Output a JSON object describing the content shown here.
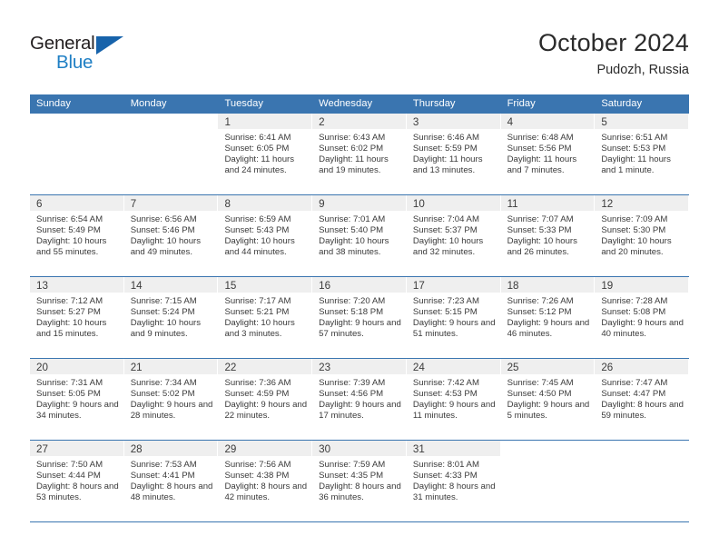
{
  "brand": {
    "name_top": "General",
    "name_bottom": "Blue",
    "accent_color": "#1763ab",
    "text_color": "#231f20"
  },
  "header": {
    "title": "October 2024",
    "subtitle": "Pudozh, Russia"
  },
  "theme": {
    "header_blue": "#3a75b0",
    "daynum_band": "#efefef",
    "cell_bg": "#ffffff",
    "text": "#3a3a3a"
  },
  "calendar": {
    "weekdays": [
      "Sunday",
      "Monday",
      "Tuesday",
      "Wednesday",
      "Thursday",
      "Friday",
      "Saturday"
    ],
    "labels": {
      "sunrise": "Sunrise:",
      "sunset": "Sunset:",
      "daylight": "Daylight:"
    },
    "weeks": [
      [
        {
          "day": "",
          "sunrise": "",
          "sunset": "",
          "daylight": ""
        },
        {
          "day": "",
          "sunrise": "",
          "sunset": "",
          "daylight": ""
        },
        {
          "day": "1",
          "sunrise": "Sunrise: 6:41 AM",
          "sunset": "Sunset: 6:05 PM",
          "daylight": "Daylight: 11 hours and 24 minutes."
        },
        {
          "day": "2",
          "sunrise": "Sunrise: 6:43 AM",
          "sunset": "Sunset: 6:02 PM",
          "daylight": "Daylight: 11 hours and 19 minutes."
        },
        {
          "day": "3",
          "sunrise": "Sunrise: 6:46 AM",
          "sunset": "Sunset: 5:59 PM",
          "daylight": "Daylight: 11 hours and 13 minutes."
        },
        {
          "day": "4",
          "sunrise": "Sunrise: 6:48 AM",
          "sunset": "Sunset: 5:56 PM",
          "daylight": "Daylight: 11 hours and 7 minutes."
        },
        {
          "day": "5",
          "sunrise": "Sunrise: 6:51 AM",
          "sunset": "Sunset: 5:53 PM",
          "daylight": "Daylight: 11 hours and 1 minute."
        }
      ],
      [
        {
          "day": "6",
          "sunrise": "Sunrise: 6:54 AM",
          "sunset": "Sunset: 5:49 PM",
          "daylight": "Daylight: 10 hours and 55 minutes."
        },
        {
          "day": "7",
          "sunrise": "Sunrise: 6:56 AM",
          "sunset": "Sunset: 5:46 PM",
          "daylight": "Daylight: 10 hours and 49 minutes."
        },
        {
          "day": "8",
          "sunrise": "Sunrise: 6:59 AM",
          "sunset": "Sunset: 5:43 PM",
          "daylight": "Daylight: 10 hours and 44 minutes."
        },
        {
          "day": "9",
          "sunrise": "Sunrise: 7:01 AM",
          "sunset": "Sunset: 5:40 PM",
          "daylight": "Daylight: 10 hours and 38 minutes."
        },
        {
          "day": "10",
          "sunrise": "Sunrise: 7:04 AM",
          "sunset": "Sunset: 5:37 PM",
          "daylight": "Daylight: 10 hours and 32 minutes."
        },
        {
          "day": "11",
          "sunrise": "Sunrise: 7:07 AM",
          "sunset": "Sunset: 5:33 PM",
          "daylight": "Daylight: 10 hours and 26 minutes."
        },
        {
          "day": "12",
          "sunrise": "Sunrise: 7:09 AM",
          "sunset": "Sunset: 5:30 PM",
          "daylight": "Daylight: 10 hours and 20 minutes."
        }
      ],
      [
        {
          "day": "13",
          "sunrise": "Sunrise: 7:12 AM",
          "sunset": "Sunset: 5:27 PM",
          "daylight": "Daylight: 10 hours and 15 minutes."
        },
        {
          "day": "14",
          "sunrise": "Sunrise: 7:15 AM",
          "sunset": "Sunset: 5:24 PM",
          "daylight": "Daylight: 10 hours and 9 minutes."
        },
        {
          "day": "15",
          "sunrise": "Sunrise: 7:17 AM",
          "sunset": "Sunset: 5:21 PM",
          "daylight": "Daylight: 10 hours and 3 minutes."
        },
        {
          "day": "16",
          "sunrise": "Sunrise: 7:20 AM",
          "sunset": "Sunset: 5:18 PM",
          "daylight": "Daylight: 9 hours and 57 minutes."
        },
        {
          "day": "17",
          "sunrise": "Sunrise: 7:23 AM",
          "sunset": "Sunset: 5:15 PM",
          "daylight": "Daylight: 9 hours and 51 minutes."
        },
        {
          "day": "18",
          "sunrise": "Sunrise: 7:26 AM",
          "sunset": "Sunset: 5:12 PM",
          "daylight": "Daylight: 9 hours and 46 minutes."
        },
        {
          "day": "19",
          "sunrise": "Sunrise: 7:28 AM",
          "sunset": "Sunset: 5:08 PM",
          "daylight": "Daylight: 9 hours and 40 minutes."
        }
      ],
      [
        {
          "day": "20",
          "sunrise": "Sunrise: 7:31 AM",
          "sunset": "Sunset: 5:05 PM",
          "daylight": "Daylight: 9 hours and 34 minutes."
        },
        {
          "day": "21",
          "sunrise": "Sunrise: 7:34 AM",
          "sunset": "Sunset: 5:02 PM",
          "daylight": "Daylight: 9 hours and 28 minutes."
        },
        {
          "day": "22",
          "sunrise": "Sunrise: 7:36 AM",
          "sunset": "Sunset: 4:59 PM",
          "daylight": "Daylight: 9 hours and 22 minutes."
        },
        {
          "day": "23",
          "sunrise": "Sunrise: 7:39 AM",
          "sunset": "Sunset: 4:56 PM",
          "daylight": "Daylight: 9 hours and 17 minutes."
        },
        {
          "day": "24",
          "sunrise": "Sunrise: 7:42 AM",
          "sunset": "Sunset: 4:53 PM",
          "daylight": "Daylight: 9 hours and 11 minutes."
        },
        {
          "day": "25",
          "sunrise": "Sunrise: 7:45 AM",
          "sunset": "Sunset: 4:50 PM",
          "daylight": "Daylight: 9 hours and 5 minutes."
        },
        {
          "day": "26",
          "sunrise": "Sunrise: 7:47 AM",
          "sunset": "Sunset: 4:47 PM",
          "daylight": "Daylight: 8 hours and 59 minutes."
        }
      ],
      [
        {
          "day": "27",
          "sunrise": "Sunrise: 7:50 AM",
          "sunset": "Sunset: 4:44 PM",
          "daylight": "Daylight: 8 hours and 53 minutes."
        },
        {
          "day": "28",
          "sunrise": "Sunrise: 7:53 AM",
          "sunset": "Sunset: 4:41 PM",
          "daylight": "Daylight: 8 hours and 48 minutes."
        },
        {
          "day": "29",
          "sunrise": "Sunrise: 7:56 AM",
          "sunset": "Sunset: 4:38 PM",
          "daylight": "Daylight: 8 hours and 42 minutes."
        },
        {
          "day": "30",
          "sunrise": "Sunrise: 7:59 AM",
          "sunset": "Sunset: 4:35 PM",
          "daylight": "Daylight: 8 hours and 36 minutes."
        },
        {
          "day": "31",
          "sunrise": "Sunrise: 8:01 AM",
          "sunset": "Sunset: 4:33 PM",
          "daylight": "Daylight: 8 hours and 31 minutes."
        },
        {
          "day": "",
          "sunrise": "",
          "sunset": "",
          "daylight": ""
        },
        {
          "day": "",
          "sunrise": "",
          "sunset": "",
          "daylight": ""
        }
      ]
    ]
  }
}
